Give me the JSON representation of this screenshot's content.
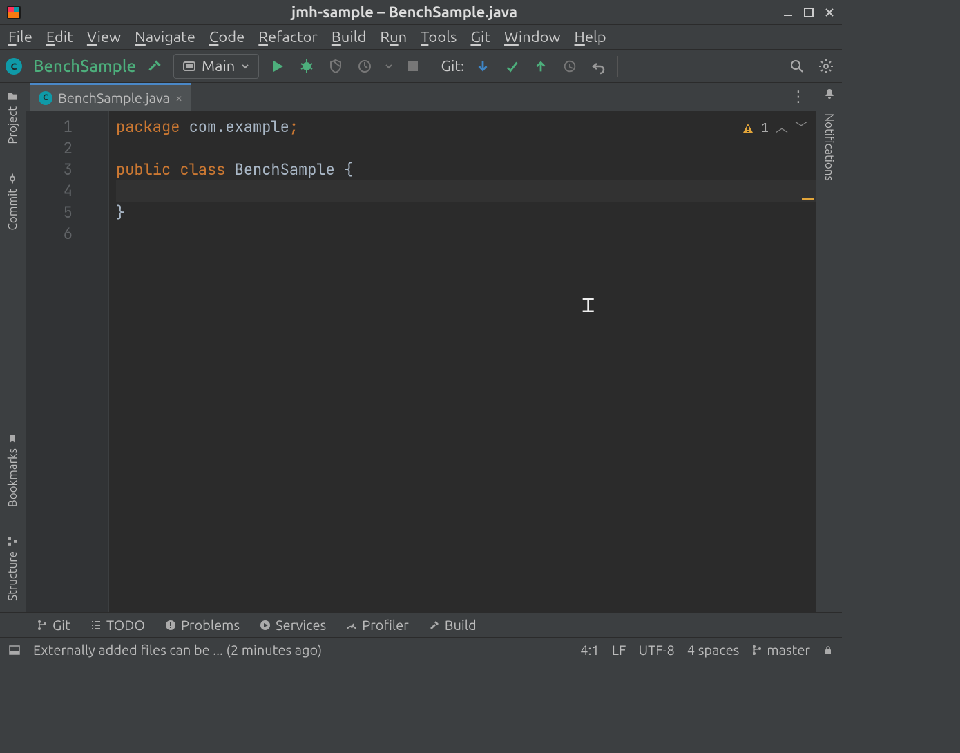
{
  "window": {
    "title": "jmh-sample – BenchSample.java"
  },
  "menu": {
    "file": "File",
    "edit": "Edit",
    "view": "View",
    "navigate": "Navigate",
    "code": "Code",
    "refactor": "Refactor",
    "build": "Build",
    "run": "Run",
    "tools": "Tools",
    "git": "Git",
    "window": "Window",
    "help": "Help"
  },
  "toolbar": {
    "breadcrumb": "BenchSample",
    "run_config": "Main",
    "git_label": "Git:"
  },
  "left_tools": {
    "project": "Project",
    "commit": "Commit",
    "bookmarks": "Bookmarks",
    "structure": "Structure"
  },
  "right_tools": {
    "notifications": "Notifications"
  },
  "tab": {
    "filename": "BenchSample.java"
  },
  "inspection": {
    "warning_count": "1"
  },
  "code": {
    "line1_kw": "package",
    "line1_pkg": " com.example",
    "line1_semi": ";",
    "line3_kw1": "public",
    "line3_kw2": "class",
    "line3_cls": "BenchSample",
    "line3_brace": " {",
    "line5_brace": "}",
    "ln1": "1",
    "ln2": "2",
    "ln3": "3",
    "ln4": "4",
    "ln5": "5",
    "ln6": "6"
  },
  "bottom": {
    "git": "Git",
    "todo": "TODO",
    "problems": "Problems",
    "services": "Services",
    "profiler": "Profiler",
    "build": "Build"
  },
  "status": {
    "message": "Externally added files can be ... (2 minutes ago)",
    "caret": "4:1",
    "line_sep": "LF",
    "encoding": "UTF-8",
    "indent": "4 spaces",
    "branch": "master"
  }
}
